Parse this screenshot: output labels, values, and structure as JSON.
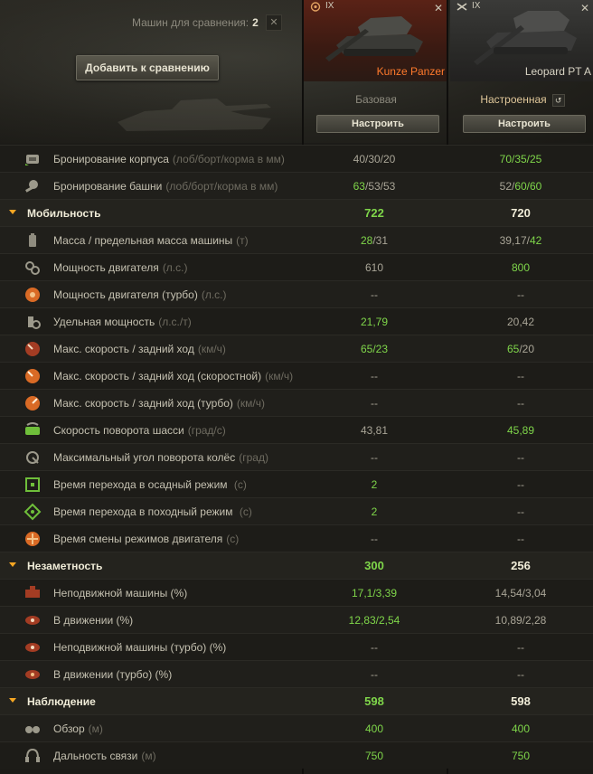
{
  "header": {
    "compare_label": "Машин для сравнения:",
    "compare_count": "2",
    "add_button": "Добавить к сравнению"
  },
  "vehicles": [
    {
      "tier": "IX",
      "name": "Kunze Panzer",
      "config": "Базовая",
      "setup_button": "Настроить",
      "name_color": "#ff7a2c"
    },
    {
      "tier": "IX",
      "name": "Leopard PT A",
      "config": "Настроенная",
      "setup_button": "Настроить",
      "name_color": "#d8d4c4"
    }
  ],
  "rows": [
    {
      "type": "stat",
      "icon": "hull-armor-icon",
      "label": "Бронирование корпуса",
      "unit": "(лоб/борт/корма в мм)",
      "v1": [
        [
          "40/30/20",
          false
        ]
      ],
      "v2": [
        [
          "70/35/25",
          true
        ]
      ]
    },
    {
      "type": "stat",
      "icon": "turret-armor-icon",
      "label": "Бронирование башни",
      "unit": "(лоб/борт/корма в мм)",
      "v1": [
        [
          "63",
          true
        ],
        [
          "/53/53",
          false
        ]
      ],
      "v2": [
        [
          "52/",
          false
        ],
        [
          "60/60",
          true
        ]
      ]
    },
    {
      "type": "section",
      "label": "Мобильность",
      "v1": "722",
      "v2": "720"
    },
    {
      "type": "stat",
      "icon": "weight-icon",
      "label": "Масса / предельная масса машины",
      "unit": "(т)",
      "v1": [
        [
          "28",
          true
        ],
        [
          "/31",
          false
        ]
      ],
      "v2": [
        [
          "39,17/",
          false
        ],
        [
          "42",
          true
        ]
      ]
    },
    {
      "type": "stat",
      "icon": "engine-power-icon",
      "label": "Мощность двигателя",
      "unit": "(л.с.)",
      "v1": [
        [
          "610",
          false
        ]
      ],
      "v2": [
        [
          "800",
          true
        ]
      ]
    },
    {
      "type": "stat",
      "icon": "engine-turbo-icon",
      "label": "Мощность двигателя (турбо)",
      "unit": "(л.с.)",
      "v1": [
        [
          "--",
          false
        ]
      ],
      "v2": [
        [
          "--",
          false
        ]
      ]
    },
    {
      "type": "stat",
      "icon": "power-ratio-icon",
      "label": "Удельная мощность",
      "unit": "(л.с./т)",
      "v1": [
        [
          "21,79",
          true
        ]
      ],
      "v2": [
        [
          "20,42",
          false
        ]
      ]
    },
    {
      "type": "stat",
      "icon": "speed-icon",
      "label": "Макс. скорость / задний ход",
      "unit": "(км/ч)",
      "v1": [
        [
          "65/23",
          true
        ]
      ],
      "v2": [
        [
          "65",
          true
        ],
        [
          "/20",
          false
        ]
      ]
    },
    {
      "type": "stat",
      "icon": "speed-fast-icon",
      "label": "Макс. скорость / задний ход (скоростной)",
      "unit": "(км/ч)",
      "v1": [
        [
          "--",
          false
        ]
      ],
      "v2": [
        [
          "--",
          false
        ]
      ]
    },
    {
      "type": "stat",
      "icon": "speed-turbo-icon",
      "label": "Макс. скорость / задний ход (турбо)",
      "unit": "(км/ч)",
      "v1": [
        [
          "--",
          false
        ]
      ],
      "v2": [
        [
          "--",
          false
        ]
      ]
    },
    {
      "type": "stat",
      "icon": "traverse-icon",
      "label": "Скорость поворота шасси",
      "unit": "(град/с)",
      "v1": [
        [
          "43,81",
          false
        ]
      ],
      "v2": [
        [
          "45,89",
          true
        ]
      ]
    },
    {
      "type": "stat",
      "icon": "wheel-angle-icon",
      "label": "Максимальный угол поворота колёс",
      "unit": "(град)",
      "v1": [
        [
          "--",
          false
        ]
      ],
      "v2": [
        [
          "--",
          false
        ]
      ]
    },
    {
      "type": "stat",
      "icon": "siege-mode-icon",
      "label": "Время перехода в осадный режим",
      "unit": " (с)",
      "v1": [
        [
          "2",
          true
        ]
      ],
      "v2": [
        [
          "--",
          false
        ]
      ]
    },
    {
      "type": "stat",
      "icon": "travel-mode-icon",
      "label": "Время перехода в походный режим",
      "unit": " (с)",
      "v1": [
        [
          "2",
          true
        ]
      ],
      "v2": [
        [
          "--",
          false
        ]
      ]
    },
    {
      "type": "stat",
      "icon": "engine-mode-icon",
      "label": "Время смены режимов двигателя",
      "unit": "(с)",
      "v1": [
        [
          "--",
          false
        ]
      ],
      "v2": [
        [
          "--",
          false
        ]
      ]
    },
    {
      "type": "section",
      "label": "Незаметность",
      "v1": "300",
      "v2": "256"
    },
    {
      "type": "stat",
      "icon": "camo-still-icon",
      "label": "Неподвижной машины (%)",
      "unit": "",
      "v1": [
        [
          "17,1/3,39",
          true
        ]
      ],
      "v2": [
        [
          "14,54/3,04",
          false
        ]
      ]
    },
    {
      "type": "stat",
      "icon": "camo-moving-icon",
      "label": "В движении (%)",
      "unit": "",
      "v1": [
        [
          "12,83/2,54",
          true
        ]
      ],
      "v2": [
        [
          "10,89/2,28",
          false
        ]
      ]
    },
    {
      "type": "stat",
      "icon": "camo-still-turbo-icon",
      "label": "Неподвижной машины (турбо) (%)",
      "unit": "",
      "v1": [
        [
          "--",
          false
        ]
      ],
      "v2": [
        [
          "--",
          false
        ]
      ]
    },
    {
      "type": "stat",
      "icon": "camo-moving-turbo-icon",
      "label": "В движении (турбо) (%)",
      "unit": "",
      "v1": [
        [
          "--",
          false
        ]
      ],
      "v2": [
        [
          "--",
          false
        ]
      ]
    },
    {
      "type": "section",
      "label": "Наблюдение",
      "v1": "598",
      "v2": "598"
    },
    {
      "type": "stat",
      "icon": "view-range-icon",
      "label": "Обзор",
      "unit": "(м)",
      "v1": [
        [
          "400",
          true
        ]
      ],
      "v2": [
        [
          "400",
          true
        ]
      ]
    },
    {
      "type": "stat",
      "icon": "radio-range-icon",
      "label": "Дальность связи",
      "unit": "(м)",
      "v1": [
        [
          "750",
          true
        ]
      ],
      "v2": [
        [
          "750",
          true
        ]
      ]
    }
  ]
}
